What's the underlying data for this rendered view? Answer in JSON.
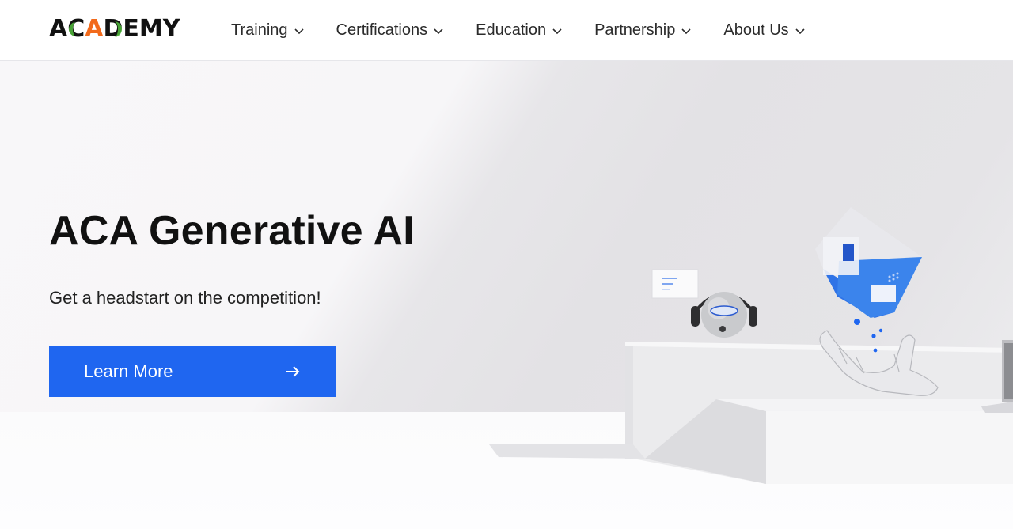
{
  "brand": {
    "logo_text_parts": [
      "A",
      "C",
      "A",
      "D",
      "EMY"
    ],
    "accent_orange": "#f26a1b",
    "accent_green": "#4fb23b",
    "primary_blue": "#1f66f0"
  },
  "nav": {
    "items": [
      {
        "label": "Training",
        "icon": "chevron-down-icon"
      },
      {
        "label": "Certifications",
        "icon": "chevron-down-icon"
      },
      {
        "label": "Education",
        "icon": "chevron-down-icon"
      },
      {
        "label": "Partnership",
        "icon": "chevron-down-icon"
      },
      {
        "label": "About Us",
        "icon": "chevron-down-icon"
      }
    ]
  },
  "hero": {
    "title": "ACA Generative AI",
    "subtitle": "Get a headstart on the competition!",
    "cta_label": "Learn More",
    "cta_icon": "arrow-right-icon",
    "illustration": "robot-hand-cube-illustration"
  }
}
